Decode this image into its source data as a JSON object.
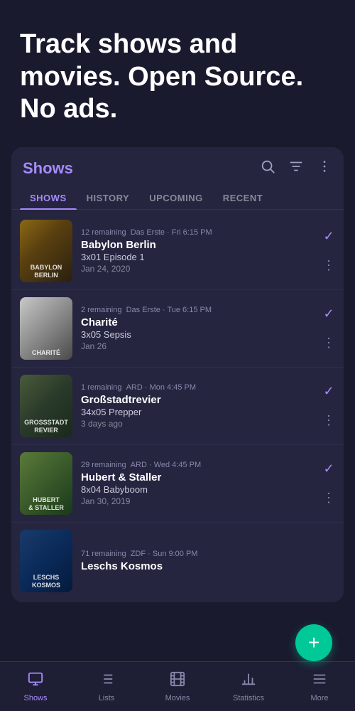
{
  "hero": {
    "title": "Track shows and movies. Open Source. No ads."
  },
  "card": {
    "title": "Shows",
    "tabs": [
      {
        "label": "SHOWS",
        "active": true
      },
      {
        "label": "HISTORY",
        "active": false
      },
      {
        "label": "UPCOMING",
        "active": false
      },
      {
        "label": "RECENT",
        "active": false
      }
    ]
  },
  "shows": [
    {
      "id": "babylon-berlin",
      "remaining": "12 remaining",
      "channel": "Das Erste",
      "time": "Fri 6:15 PM",
      "title": "Babylon Berlin",
      "episode": "3x01 Episode 1",
      "date": "Jan 24, 2020",
      "posterClass": "poster-babylon",
      "posterText": "BABYLON BERLIN"
    },
    {
      "id": "charite",
      "remaining": "2 remaining",
      "channel": "Das Erste",
      "time": "Tue 6:15 PM",
      "title": "Charité",
      "episode": "3x05 Sepsis",
      "date": "Jan 26",
      "posterClass": "poster-charite",
      "posterText": "CHARITÉ"
    },
    {
      "id": "grossstadtrevier",
      "remaining": "1 remaining",
      "channel": "ARD",
      "time": "Mon 4:45 PM",
      "title": "Großstadtrevier",
      "episode": "34x05 Prepper",
      "date": "3 days ago",
      "posterClass": "poster-gross",
      "posterText": "GROSSSTADT REVIER"
    },
    {
      "id": "hubert-staller",
      "remaining": "29 remaining",
      "channel": "ARD",
      "time": "Wed 4:45 PM",
      "title": "Hubert & Staller",
      "episode": "8x04 Babyboom",
      "date": "Jan 30, 2019",
      "posterClass": "poster-hubert",
      "posterText": "HUBERT UND STALLER"
    },
    {
      "id": "leschs-kosmos",
      "remaining": "71 remaining",
      "channel": "ZDF",
      "time": "Sun 9:00 PM",
      "title": "Leschs Kosmos",
      "episode": "",
      "date": "",
      "posterClass": "poster-leschs",
      "posterText": "LESCHS KOSMOS"
    }
  ],
  "fab": {
    "label": "+"
  },
  "bottomNav": [
    {
      "id": "shows",
      "label": "Shows",
      "active": true
    },
    {
      "id": "lists",
      "label": "Lists",
      "active": false
    },
    {
      "id": "movies",
      "label": "Movies",
      "active": false
    },
    {
      "id": "statistics",
      "label": "Statistics",
      "active": false
    },
    {
      "id": "more",
      "label": "More",
      "active": false
    }
  ]
}
